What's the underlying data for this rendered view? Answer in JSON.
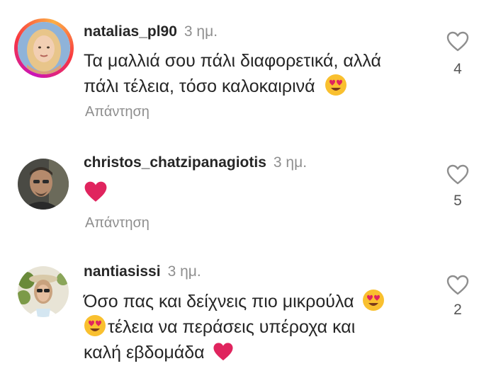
{
  "comments": [
    {
      "username": "natalias_pl90",
      "time": "3 ημ.",
      "lines": [
        "Τα μαλλιά σου πάλι διαφορετικά, αλλά",
        "πάλι τέλεια, τόσο καλοκαιρινά"
      ],
      "reply_label": "Απάντηση",
      "likes": "4",
      "avatar_icon": "profile-photo-blonde-woman",
      "has_story_ring": true
    },
    {
      "username": "christos_chatzipanagiotis",
      "time": "3 ημ.",
      "lines": [],
      "reply_label": "Απάντηση",
      "likes": "5",
      "avatar_icon": "profile-photo-man",
      "has_story_ring": false
    },
    {
      "username": "nantiasissi",
      "time": "3 ημ.",
      "lines": [
        "Όσο πας και δείχνεις πιο μικρούλα",
        "τέλεια να περάσεις υπέροχα και",
        "καλή εβδομάδα"
      ],
      "likes": "2",
      "avatar_icon": "profile-photo-woman-sunglasses",
      "has_story_ring": false
    }
  ],
  "icons": {
    "like": "heart-outline-icon",
    "emoji_heart_eyes": "smiling-face-with-heart-eyes-emoji",
    "emoji_red_heart": "red-heart-emoji"
  },
  "colors": {
    "username": "#262626",
    "muted": "#8e8e8e",
    "heart": "#e0245e",
    "emoji_face": "#f9c02f"
  }
}
